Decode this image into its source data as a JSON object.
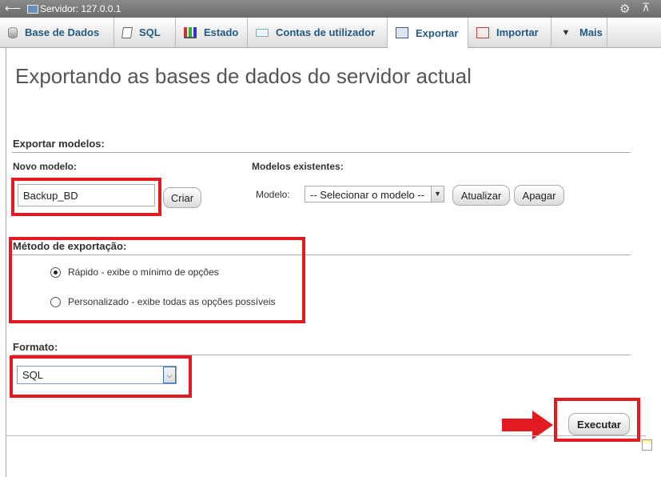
{
  "titlebar": {
    "title": "Servidor: 127.0.0.1"
  },
  "tabs": [
    {
      "label": "Base de Dados",
      "icon": "database-icon"
    },
    {
      "label": "SQL",
      "icon": "sql-icon"
    },
    {
      "label": "Estado",
      "icon": "status-chart-icon"
    },
    {
      "label": "Contas de utilizador",
      "icon": "users-icon"
    },
    {
      "label": "Exportar",
      "icon": "export-icon",
      "active": true
    },
    {
      "label": "Importar",
      "icon": "import-icon"
    },
    {
      "label": "Mais",
      "icon": "chevron-down-icon"
    }
  ],
  "page": {
    "heading": "Exportando as bases de dados do servidor actual"
  },
  "templates": {
    "section_title": "Exportar modelos:",
    "new_label": "Novo modelo:",
    "new_value": "Backup_BD",
    "create_button": "Criar",
    "existing_label": "Modelos existentes:",
    "model_label": "Modelo:",
    "model_select": "-- Selecionar o modelo --",
    "update_button": "Atualizar",
    "delete_button": "Apagar"
  },
  "method": {
    "title": "Método de exportação:",
    "options": [
      {
        "label": "Rápido - exibe o mínimo de opções",
        "checked": true
      },
      {
        "label": "Personalizado - exibe todas as opções possíveis",
        "checked": false
      }
    ]
  },
  "format": {
    "title": "Formato:",
    "value": "SQL"
  },
  "actions": {
    "execute_button": "Executar"
  },
  "colors": {
    "highlight": "#e21b23",
    "tab_text": "#235a81",
    "heading": "#555555"
  }
}
